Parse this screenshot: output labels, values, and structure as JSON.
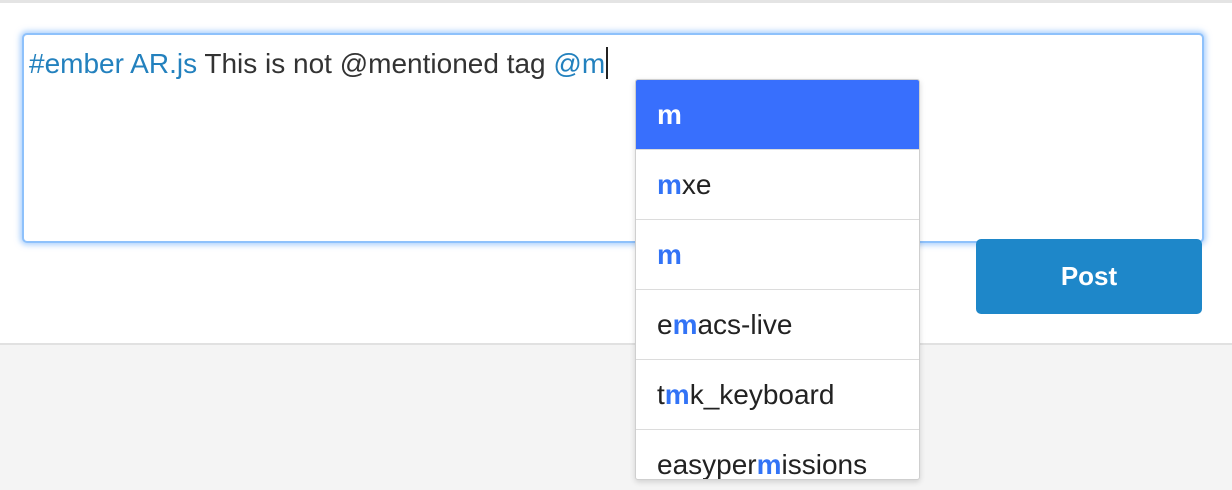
{
  "editor": {
    "tag_text": "#ember AR.js",
    "plain_text": " This is not @mentioned tag ",
    "mention_text": "@m"
  },
  "post_button": {
    "label": "Post"
  },
  "autocomplete": {
    "items": [
      {
        "pre": "",
        "match": "m",
        "post": "",
        "active": true
      },
      {
        "pre": "",
        "match": "m",
        "post": "xe",
        "active": false
      },
      {
        "pre": "",
        "match": "m",
        "post": "",
        "active": false
      },
      {
        "pre": "e",
        "match": "m",
        "post": "acs-live",
        "active": false
      },
      {
        "pre": "t",
        "match": "m",
        "post": "k_keyboard",
        "active": false
      },
      {
        "pre": "easyper",
        "match": "m",
        "post": "issions",
        "active": false
      }
    ]
  },
  "colors": {
    "accent": "#2381be",
    "highlight": "#3273f6",
    "active_bg": "#386ffd",
    "button_bg": "#1e87c9"
  }
}
